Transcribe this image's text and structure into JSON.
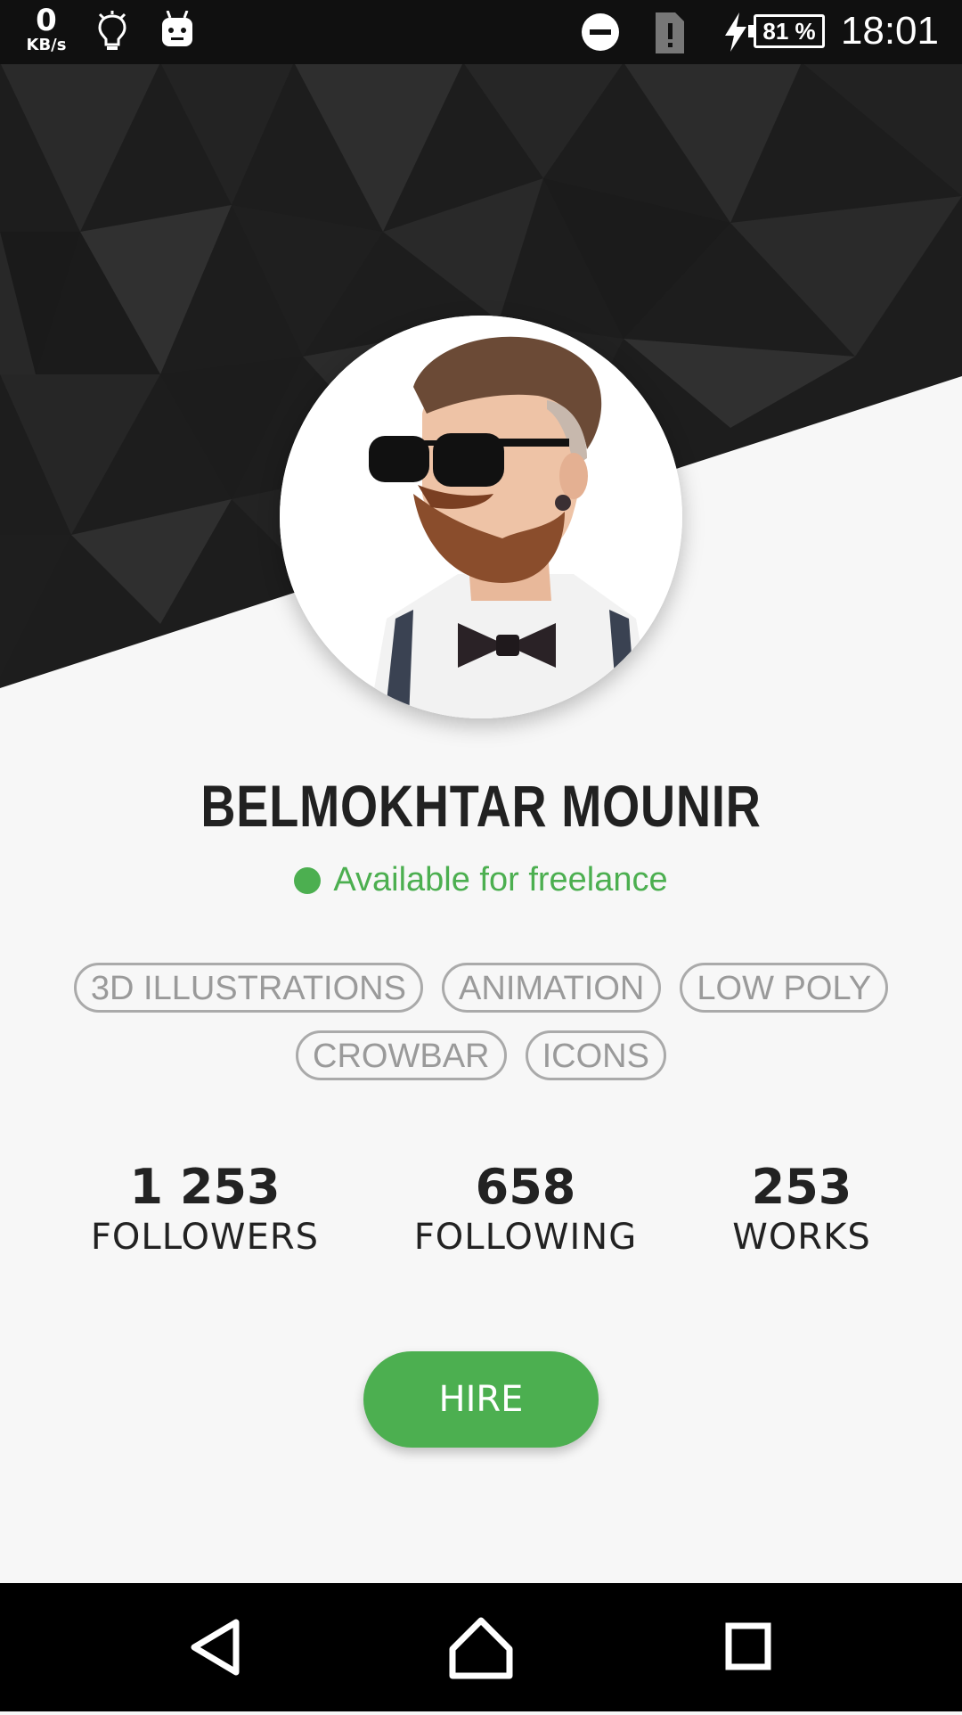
{
  "status_bar": {
    "speed_value": "0",
    "speed_unit": "KB/s",
    "battery": "81 %",
    "time": "18:01",
    "icons": [
      "data-speed",
      "lightbulb-icon",
      "android-icon",
      "do-not-disturb-icon",
      "sim-alert-icon",
      "charging-bolt-icon",
      "battery-icon"
    ]
  },
  "profile": {
    "name": "BELMOKHTAR MOUNIR",
    "availability": "Available for freelance",
    "availability_color": "#4caf50"
  },
  "tags": [
    [
      "3D ILLUSTRATIONS",
      "ANIMATION",
      "LOW POLY"
    ],
    [
      "CROWBAR",
      "ICONS"
    ]
  ],
  "stats": {
    "followers": {
      "value": "1 253",
      "label": "FOLLOWERS"
    },
    "following": {
      "value": "658",
      "label": "FOLLOWING"
    },
    "works": {
      "value": "253",
      "label": "WORKS"
    }
  },
  "actions": {
    "hire_label": "HIRE",
    "accent_color": "#4caf50"
  },
  "nav": {
    "icons": [
      "back-icon",
      "home-icon",
      "recents-icon"
    ]
  }
}
